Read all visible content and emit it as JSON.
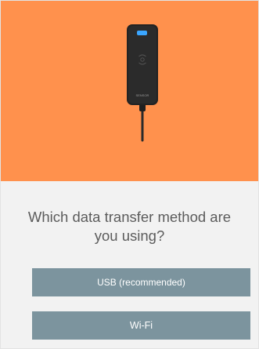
{
  "hero": {
    "background_color": "#ff914d",
    "image": "usb-sensor-device-illustration",
    "device_badge_text": "SENSOR"
  },
  "main": {
    "question": "Which data transfer method are you using?",
    "options": [
      {
        "label": "USB (recommended)"
      },
      {
        "label": "Wi-Fi"
      }
    ],
    "button_color": "#7c949e"
  }
}
